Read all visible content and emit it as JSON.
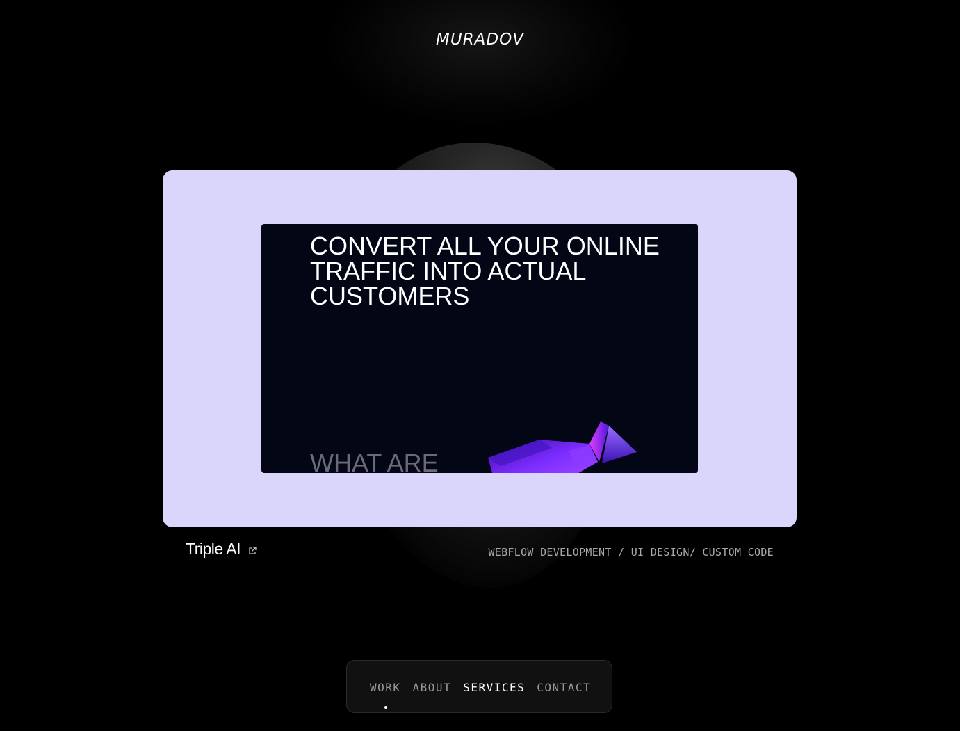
{
  "logo": {
    "text": "MURADOV"
  },
  "project": {
    "preview": {
      "headline": "CONVERT ALL YOUR ONLINE TRAFFIC INTO ACTUAL CUSTOMERS",
      "subheading": "WHAT ARE"
    },
    "title": "Triple AI",
    "link_icon": "external-link-icon",
    "tags": "WEBFLOW DEVELOPMENT / UI DESIGN/ CUSTOM CODE"
  },
  "nav": {
    "items": [
      {
        "label": "WORK",
        "active": false
      },
      {
        "label": "ABOUT",
        "active": false
      },
      {
        "label": "SERVICES",
        "active": true
      },
      {
        "label": "CONTACT",
        "active": false
      }
    ],
    "indicator_item": "WORK"
  },
  "colors": {
    "background": "#000000",
    "card": "#dad6fb",
    "preview": "#020615",
    "accent": "#7b2cff"
  }
}
